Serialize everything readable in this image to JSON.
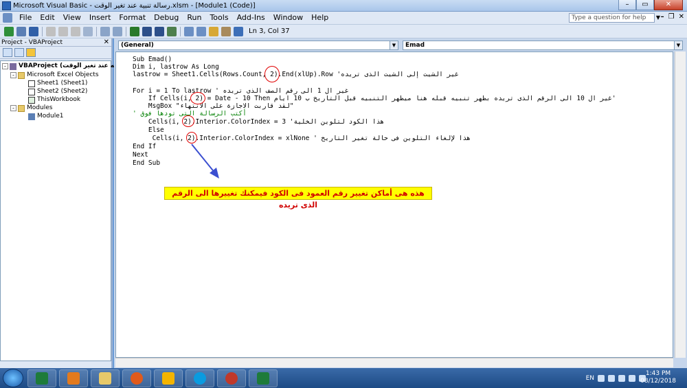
{
  "window": {
    "title": "Microsoft Visual Basic - رسالة تنبية عند تغير الوقت.xlsm - [Module1 (Code)]"
  },
  "menu": {
    "items": [
      "File",
      "Edit",
      "View",
      "Insert",
      "Format",
      "Debug",
      "Run",
      "Tools",
      "Add-Ins",
      "Window",
      "Help"
    ]
  },
  "help_box": {
    "placeholder": "Type a question for help"
  },
  "toolbar": {
    "position": "Ln 3, Col 37"
  },
  "project": {
    "title": "Project - VBAProject",
    "root": "VBAProject (تنبيه عند تغير الوقت)",
    "folders": [
      "Microsoft Excel Objects",
      "Modules"
    ],
    "objects": [
      "Sheet1 (Sheet1)",
      "Sheet2 (Sheet2)",
      "ThisWorkbook"
    ],
    "modules": [
      "Module1"
    ]
  },
  "combos": {
    "object": "(General)",
    "procedure": "Emad"
  },
  "code": {
    "lines": [
      {
        "text": "Sub Emad()",
        "type": "code"
      },
      {
        "text": "Dim i, lastrow As Long",
        "type": "code"
      },
      {
        "text": "lastrow = Sheet1.Cells(Rows.Count, 2).End(xlUp).Row 'غير الشيت إلى الشيت الذى تريده",
        "type": "code"
      },
      {
        "text": "",
        "type": "code"
      },
      {
        "text": "For i = 1 To lastrow ' غير ال 1 الى رقم الصف الذى تريده",
        "type": "code"
      },
      {
        "text": "    If Cells(i, 2) = Date - 10 Then غير ال 10 الى الرقم الذى تريده بظهر تنبيه قبله هنا ميظهر التنبيه قبل التاريخ ب 10 ايام'",
        "type": "code"
      },
      {
        "text": "    MsgBox \"لقد قاربت الاجازة على الانتهاء\"",
        "type": "code"
      },
      {
        "text": "' أكتب الرسالة التى تودها فوق",
        "type": "comment"
      },
      {
        "text": "    Cells(i, 2).Interior.ColorIndex = 3 'هذا الكود لتلوين الخلية",
        "type": "code"
      },
      {
        "text": "    Else",
        "type": "code"
      },
      {
        "text": "     Cells(i, 2).Interior.ColorIndex = xlNone ' هذا لإلغاء التلوين فى حالة تغير التاريخ",
        "type": "code"
      },
      {
        "text": "End If",
        "type": "code"
      },
      {
        "text": "Next",
        "type": "code"
      },
      {
        "text": "End Sub",
        "type": "code"
      }
    ]
  },
  "annotation": {
    "note": "هذه هى أماكن تغيير رقم العمود فى الكود فيمكنك تغييرها الى الرقم الذى تريده",
    "color": "#e00000",
    "background": "#ffff00"
  },
  "taskbar": {
    "language": "EN",
    "time": "1:43 PM",
    "date": "08/12/2018"
  }
}
